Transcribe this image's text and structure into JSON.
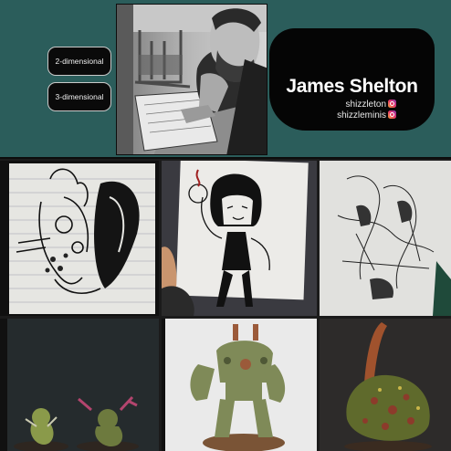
{
  "nav": {
    "button_2d": "2-dimensional",
    "button_3d": "3-dimensional"
  },
  "profile": {
    "name": "James Shelton",
    "socials": [
      {
        "handle": "shizzleton",
        "icon": "instagram-icon"
      },
      {
        "handle": "shizzleminis",
        "icon": "instagram-icon"
      }
    ]
  },
  "colors": {
    "header_bg": "#2b5d5b",
    "page_bg": "#1b1b1b",
    "card_bg": "#050505"
  }
}
